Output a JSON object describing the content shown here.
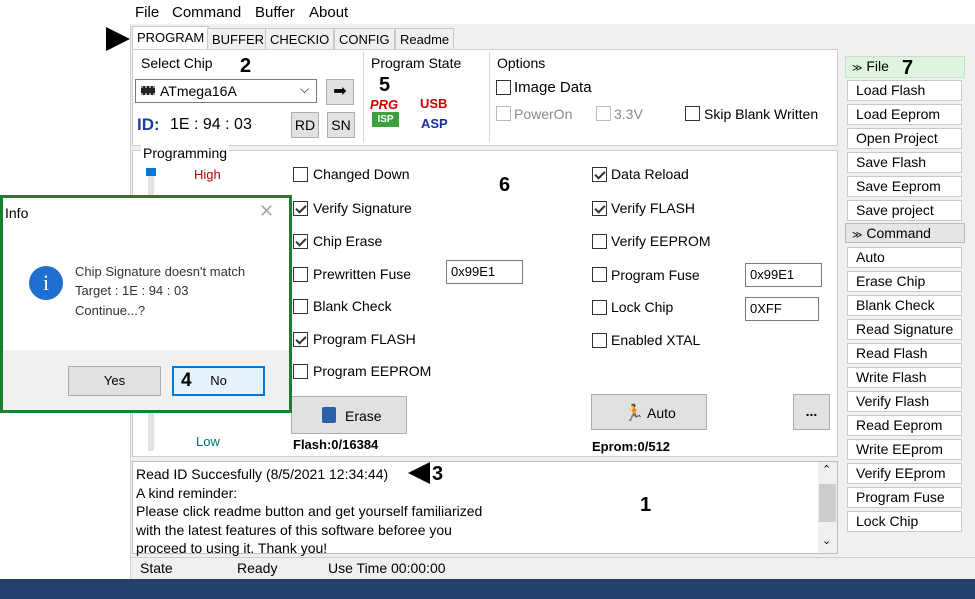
{
  "menu": {
    "file": "File",
    "command": "Command",
    "buffer": "Buffer",
    "about": "About"
  },
  "tabs": [
    "PROGRAM",
    "BUFFER",
    "CHECKIO",
    "CONFIG",
    "Readme"
  ],
  "select_chip": {
    "title": "Select Chip",
    "chip": "ATmega16A",
    "id_label": "ID:",
    "id_value": "1E : 94 : 03",
    "rd": "RD",
    "sn": "SN"
  },
  "program_state": {
    "title": "Program State",
    "prg": "PRG",
    "isp": "ISP",
    "usb": "USB",
    "asp": "ASP"
  },
  "options": {
    "title": "Options",
    "image_data": "Image Data",
    "power_on": "PowerOn",
    "v33": "3.3V",
    "skip_blank": "Skip Blank Written"
  },
  "programming": {
    "title": "Programming",
    "high": "High",
    "low": "Low",
    "changed_down": "Changed Down",
    "verify_signature": "Verify Signature",
    "chip_erase": "Chip Erase",
    "prewritten_fuse": "Prewritten Fuse",
    "prewritten_fuse_value": "0x99E1",
    "blank_check": "Blank Check",
    "program_flash": "Program FLASH",
    "program_eeprom": "Program EEPROM",
    "data_reload": "Data Reload",
    "verify_flash": "Verify FLASH",
    "verify_eeprom": "Verify EEPROM",
    "program_fuse": "Program Fuse",
    "program_fuse_value": "0x99E1",
    "lock_chip": "Lock Chip",
    "lock_chip_value": "0XFF",
    "enabled_xtal": "Enabled XTAL",
    "erase_button": "Erase",
    "auto_button": "Auto",
    "more_button": "...",
    "flash_status": "Flash:0/16384",
    "eprom_status": "Eprom:0/512"
  },
  "log": {
    "lines": [
      "Read ID Succesfully (8/5/2021 12:34:44)",
      "A kind reminder:",
      "Please click readme button and get yourself familiarized",
      "with the latest features of this software beforee you",
      "proceed to using it. Thank you!"
    ]
  },
  "status": {
    "state": "State",
    "ready": "Ready",
    "use_time": "Use Time 00:00:00"
  },
  "sidebar": {
    "file_header": "File",
    "file_items": [
      "Load Flash",
      "Load Eeprom",
      "Open Project",
      "Save Flash",
      "Save Eeprom",
      "Save project"
    ],
    "command_header": "Command",
    "command_items": [
      "Auto",
      "Erase Chip",
      "Blank Check",
      "Read Signature",
      "Read Flash",
      "Write Flash",
      "Verify Flash",
      "Read Eeprom",
      "Write EEprom",
      "Verify EEprom",
      "Program Fuse",
      "Lock Chip"
    ]
  },
  "dialog": {
    "title": "Info",
    "message1": "Chip Signature doesn't match",
    "message2": "Target : 1E : 94 : 03",
    "message3": "Continue...?",
    "yes": "Yes",
    "no": "No"
  },
  "annotations": {
    "n1": "1",
    "n2": "2",
    "n3": "3",
    "n4": "4",
    "n5": "5",
    "n6": "6",
    "n7": "7"
  },
  "colors": {
    "dialog_border": "#1a7f33",
    "id_blue": "#1b3fa0",
    "high_red": "#c00000",
    "low_teal": "#007070",
    "info_icon": "#1e6fd0"
  }
}
